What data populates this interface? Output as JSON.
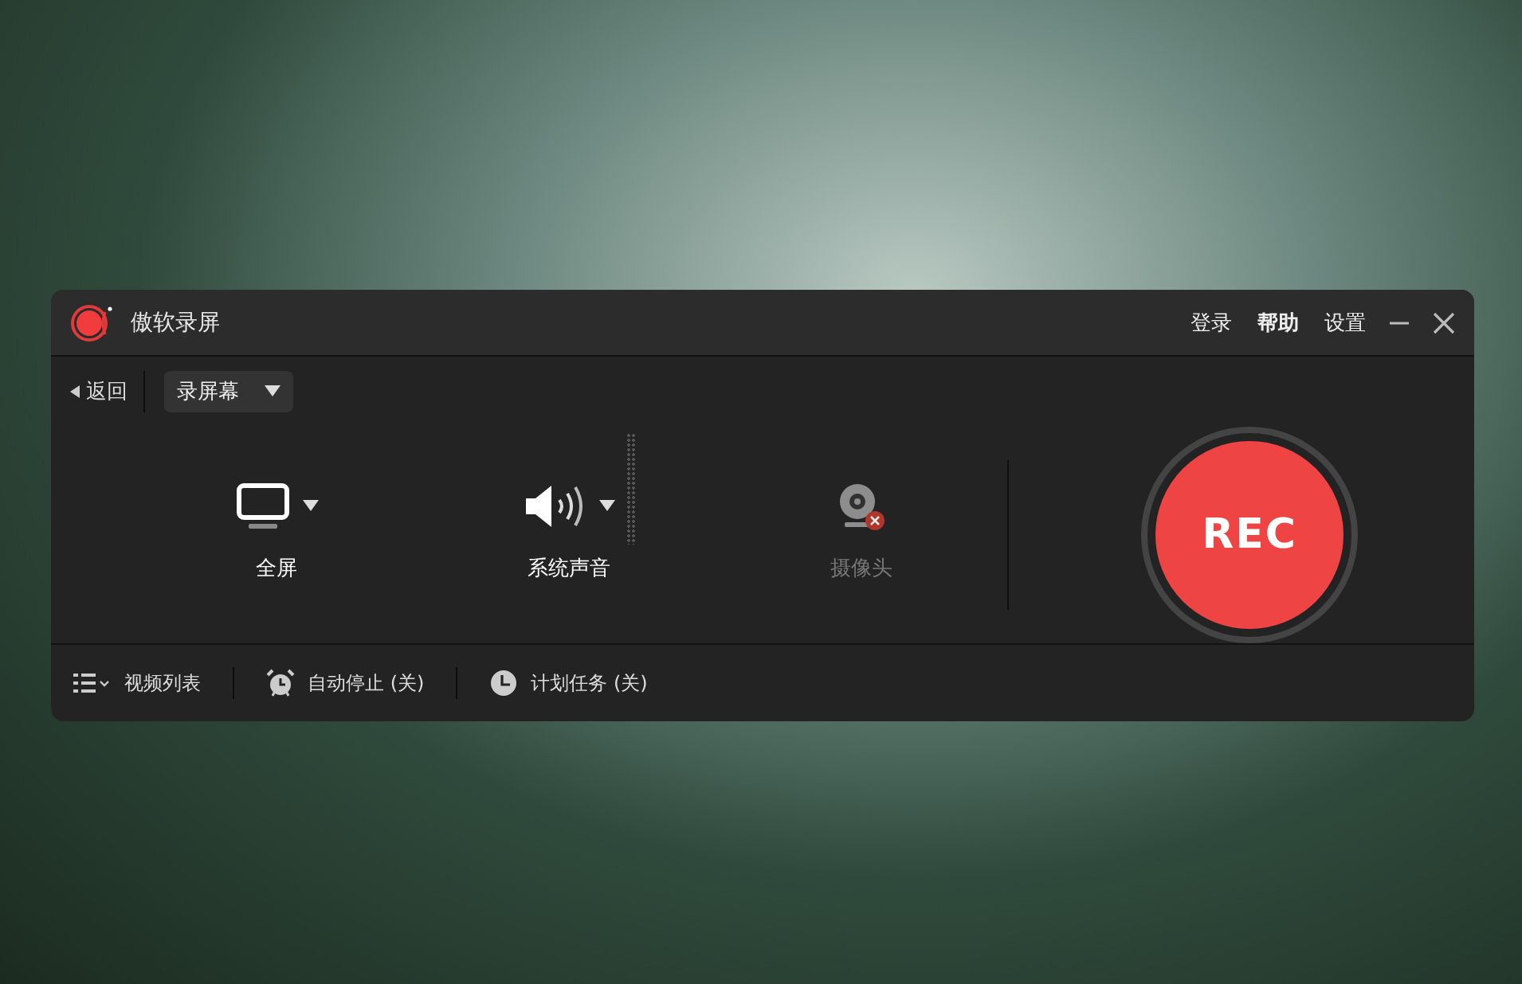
{
  "window": {
    "title": "傲软录屏",
    "menu": [
      "登录",
      "帮助",
      "设置"
    ]
  },
  "toolbar": {
    "back": "返回",
    "mode": "录屏幕"
  },
  "sources": [
    {
      "kind": "screen",
      "label": "全屏",
      "disabled": false,
      "dropdown": true
    },
    {
      "kind": "audio",
      "label": "系统声音",
      "disabled": false,
      "dropdown": true
    },
    {
      "kind": "webcam",
      "label": "摄像头",
      "disabled": true,
      "dropdown": false
    }
  ],
  "rec_button": "REC",
  "bottom_bar": [
    {
      "kind": "list",
      "label": "视频列表"
    },
    {
      "kind": "alarm",
      "label": "自动停止 (关)"
    },
    {
      "kind": "clock",
      "label": "计划任务 (关)"
    }
  ]
}
